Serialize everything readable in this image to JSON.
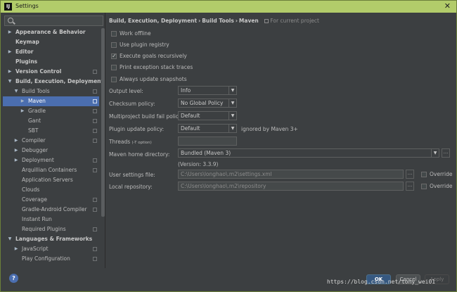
{
  "window": {
    "title": "Settings",
    "app_icon": "IJ",
    "close_glyph": "✕"
  },
  "search": {
    "placeholder": ""
  },
  "sidebar": {
    "items": [
      {
        "label": "Appearance & Behavior",
        "level": 0,
        "arrow": "▶",
        "bold": true,
        "proj": false
      },
      {
        "label": "Keymap",
        "level": 0,
        "arrow": "",
        "bold": true,
        "proj": false
      },
      {
        "label": "Editor",
        "level": 0,
        "arrow": "▶",
        "bold": true,
        "proj": false
      },
      {
        "label": "Plugins",
        "level": 0,
        "arrow": "",
        "bold": true,
        "proj": false
      },
      {
        "label": "Version Control",
        "level": 0,
        "arrow": "▶",
        "bold": true,
        "proj": true
      },
      {
        "label": "Build, Execution, Deployment",
        "level": 0,
        "arrow": "▼",
        "bold": true,
        "proj": false
      },
      {
        "label": "Build Tools",
        "level": 1,
        "arrow": "▼",
        "bold": false,
        "proj": true
      },
      {
        "label": "Maven",
        "level": 2,
        "arrow": "▶",
        "bold": false,
        "proj": true,
        "selected": true
      },
      {
        "label": "Gradle",
        "level": 2,
        "arrow": "▶",
        "bold": false,
        "proj": true
      },
      {
        "label": "Gant",
        "level": 2,
        "arrow": "",
        "bold": false,
        "proj": true
      },
      {
        "label": "SBT",
        "level": 2,
        "arrow": "",
        "bold": false,
        "proj": true
      },
      {
        "label": "Compiler",
        "level": 1,
        "arrow": "▶",
        "bold": false,
        "proj": true
      },
      {
        "label": "Debugger",
        "level": 1,
        "arrow": "▶",
        "bold": false,
        "proj": false
      },
      {
        "label": "Deployment",
        "level": 1,
        "arrow": "▶",
        "bold": false,
        "proj": true
      },
      {
        "label": "Arquillian Containers",
        "level": 1,
        "arrow": "",
        "bold": false,
        "proj": true
      },
      {
        "label": "Application Servers",
        "level": 1,
        "arrow": "",
        "bold": false,
        "proj": false
      },
      {
        "label": "Clouds",
        "level": 1,
        "arrow": "",
        "bold": false,
        "proj": false
      },
      {
        "label": "Coverage",
        "level": 1,
        "arrow": "",
        "bold": false,
        "proj": true
      },
      {
        "label": "Gradle-Android Compiler",
        "level": 1,
        "arrow": "",
        "bold": false,
        "proj": true
      },
      {
        "label": "Instant Run",
        "level": 1,
        "arrow": "",
        "bold": false,
        "proj": false
      },
      {
        "label": "Required Plugins",
        "level": 1,
        "arrow": "",
        "bold": false,
        "proj": true
      },
      {
        "label": "Languages & Frameworks",
        "level": 0,
        "arrow": "▼",
        "bold": true,
        "proj": false
      },
      {
        "label": "JavaScript",
        "level": 1,
        "arrow": "▶",
        "bold": false,
        "proj": true
      },
      {
        "label": "Play Configuration",
        "level": 1,
        "arrow": "",
        "bold": false,
        "proj": true
      }
    ]
  },
  "breadcrumb": {
    "parts": [
      "Build, Execution, Deployment",
      "Build Tools",
      "Maven"
    ],
    "separator": "›",
    "scope": "For current project"
  },
  "checkboxes": [
    {
      "label": "Work offline",
      "checked": false
    },
    {
      "label": "Use plugin registry",
      "checked": false
    },
    {
      "label": "Execute goals recursively",
      "checked": true
    },
    {
      "label": "Print exception stack traces",
      "checked": false
    },
    {
      "label": "Always update snapshots",
      "checked": false
    }
  ],
  "output_level": {
    "label": "Output level:",
    "value": "Info"
  },
  "checksum_policy": {
    "label": "Checksum policy:",
    "value": "No Global Policy"
  },
  "fail_policy": {
    "label": "Multiproject build fail policy:",
    "value": "Default"
  },
  "update_policy": {
    "label": "Plugin update policy:",
    "value": "Default",
    "note": "ignored by Maven 3+"
  },
  "threads": {
    "label": "Threads",
    "hint": "(-T option)",
    "value": ""
  },
  "maven_home": {
    "label": "Maven home directory:",
    "value": "Bundled (Maven 3)",
    "version": "(Version: 3.3.9)"
  },
  "user_settings": {
    "label": "User settings file:",
    "value": "C:\\Users\\longhao\\.m2\\settings.xml",
    "override": "Override"
  },
  "local_repo": {
    "label": "Local repository:",
    "value": "C:\\Users\\longhao\\.m2\\repository",
    "override": "Override"
  },
  "footer": {
    "help": "?",
    "ok": "OK",
    "cancel": "Cancel",
    "apply": "Apply"
  },
  "watermark": "https://blog.csdn.net/tony_wei01",
  "colors": {
    "selection": "#4b6eaf",
    "background": "#3c3f41",
    "titlebar": "#b2cc6a"
  }
}
